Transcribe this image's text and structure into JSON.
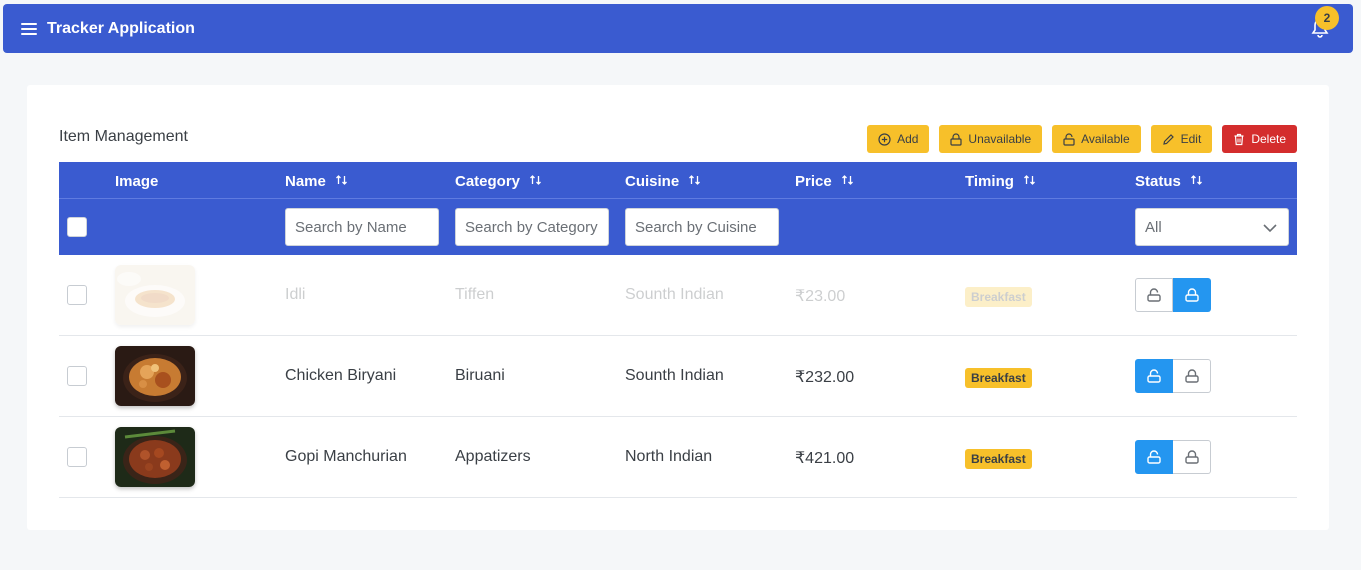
{
  "app": {
    "title": "Tracker Application",
    "notification_count": "2"
  },
  "page": {
    "title": "Item Management"
  },
  "toolbar": {
    "add": "Add",
    "unavailable": "Unavailable",
    "available": "Available",
    "edit": "Edit",
    "delete": "Delete"
  },
  "table": {
    "columns": {
      "image": "Image",
      "name": "Name",
      "category": "Category",
      "cuisine": "Cuisine",
      "price": "Price",
      "timing": "Timing",
      "status": "Status"
    },
    "filters": {
      "name_placeholder": "Search by Name",
      "category_placeholder": "Search by Category",
      "cuisine_placeholder": "Search by Cuisine",
      "status_value": "All"
    },
    "rows": [
      {
        "name": "Idli",
        "category": "Tiffen",
        "cuisine": "Sounth Indian",
        "price": "₹23.00",
        "timing": "Breakfast",
        "status": "unavailable",
        "image_icon": "idli-photo"
      },
      {
        "name": "Chicken Biryani",
        "category": "Biruani",
        "cuisine": "Sounth Indian",
        "price": "₹232.00",
        "timing": "Breakfast",
        "status": "available",
        "image_icon": "biryani-photo"
      },
      {
        "name": "Gopi Manchurian",
        "category": "Appatizers",
        "cuisine": "North Indian",
        "price": "₹421.00",
        "timing": "Breakfast",
        "status": "available",
        "image_icon": "manchurian-photo"
      }
    ]
  },
  "colors": {
    "primary": "#3a5bd0",
    "warning": "#f7c02a",
    "danger": "#d42d2d",
    "toggle_active": "#2496f0"
  }
}
